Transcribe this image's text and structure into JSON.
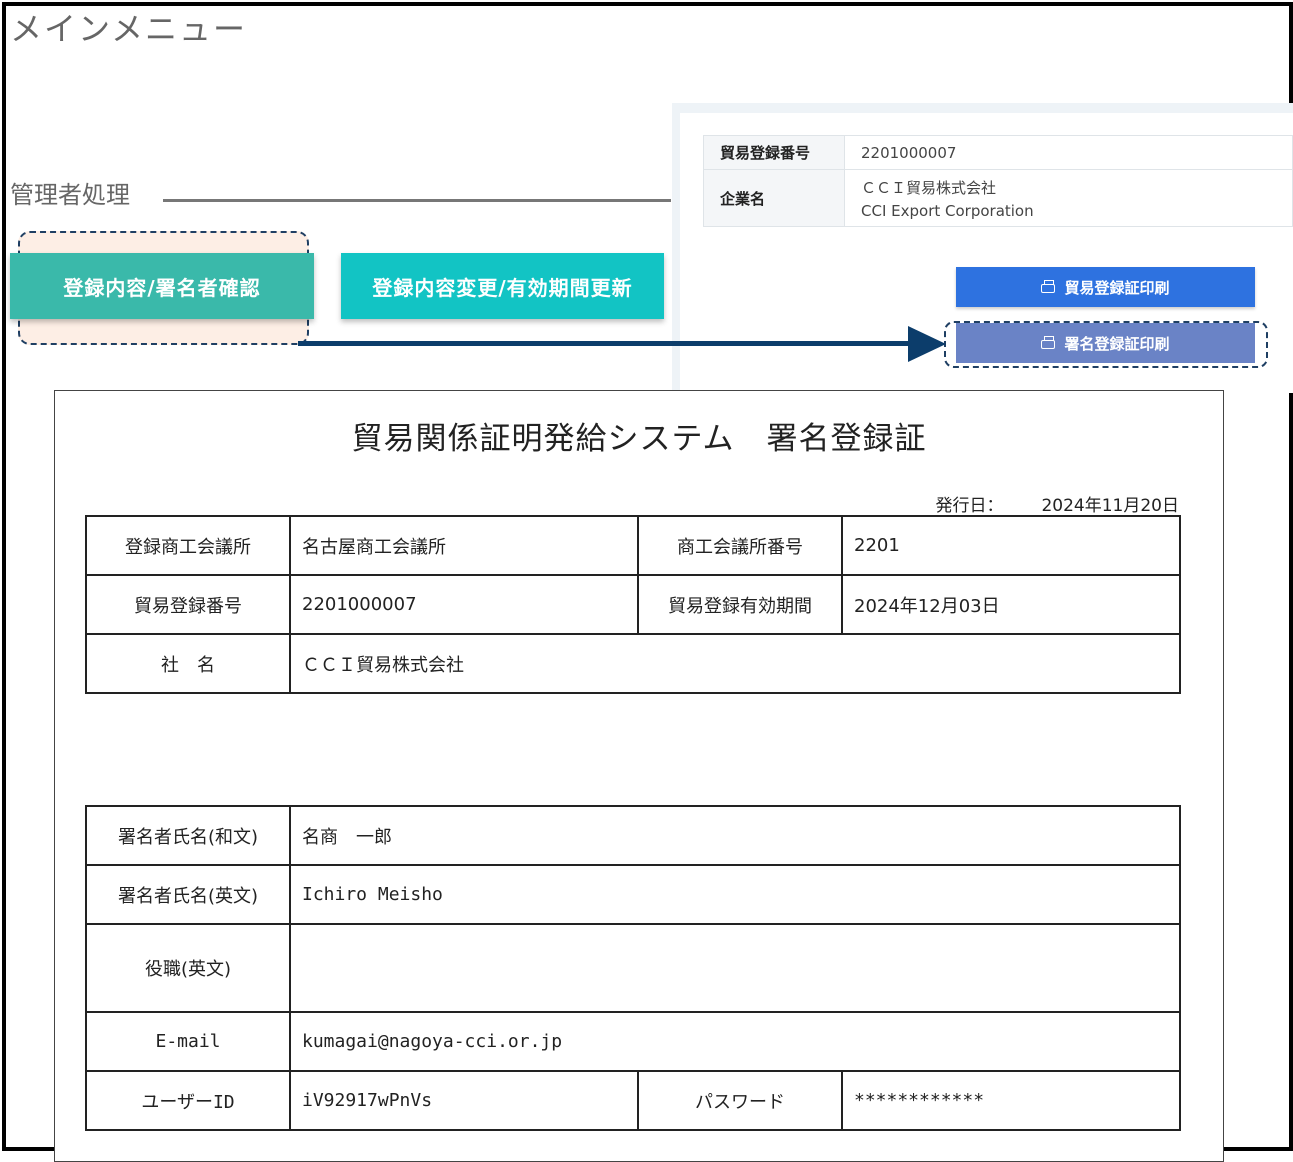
{
  "main_title": "メインメニュー",
  "admin": {
    "label": "管理者処理",
    "confirm_button": "登録内容/署名者確認",
    "change_button": "登録内容変更/有効期間更新"
  },
  "info_panel": {
    "rows": [
      {
        "label": "貿易登録番号",
        "value": "2201000007"
      },
      {
        "label": "企業名",
        "value": "ＣＣＩ貿易株式会社",
        "value2": "CCI Export Corporation"
      }
    ],
    "print_trade_button": "貿易登録証印刷",
    "print_signature_button": "署名登録証印刷"
  },
  "certificate": {
    "title": "貿易関係証明発給システム　署名登録証",
    "issue_label": "発行日：",
    "issue_date": "2024年11月20日",
    "org_label": "登録商工会議所",
    "org_value": "名古屋商工会議所",
    "org_no_label": "商工会議所番号",
    "org_no_value": "2201",
    "trade_no_label": "貿易登録番号",
    "trade_no_value": "2201000007",
    "validity_label": "貿易登録有効期間",
    "validity_value": "2024年12月03日",
    "company_label": "社　名",
    "company_value": "ＣＣＩ貿易株式会社",
    "signer_jp_label": "署名者氏名(和文)",
    "signer_jp_value": "名商　一郎",
    "signer_en_label": "署名者氏名(英文)",
    "signer_en_value": "Ichiro Meisho",
    "title_en_label": "役職(英文)",
    "title_en_value": "",
    "email_label": "E-mail",
    "email_value": "kumagai@nagoya-cci.or.jp",
    "userid_label": "ユーザーID",
    "userid_value": "iV92917wPnVs",
    "password_label": "パスワード",
    "password_value": "************"
  },
  "colors": {
    "teal": "#12c4c4",
    "teal_selected": "#3ab9aa",
    "blue_button": "#2e72e0",
    "purple_button": "#6a83c6",
    "arrow": "#0c3d6b"
  }
}
